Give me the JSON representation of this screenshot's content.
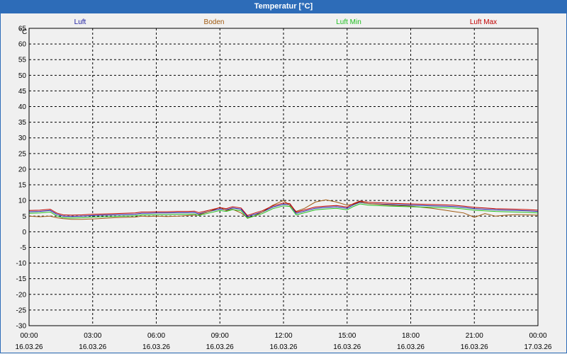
{
  "window": {
    "title": "Temperatur [°C]"
  },
  "chart_data": {
    "type": "line",
    "title": "Temperatur [°C]",
    "ylabel": "°C",
    "xlabel": "",
    "ylim": [
      -30,
      65
    ],
    "y_ticks": [
      65,
      60,
      55,
      50,
      45,
      40,
      35,
      30,
      25,
      20,
      15,
      10,
      5,
      0,
      -5,
      -10,
      -15,
      -20,
      -25,
      -30
    ],
    "x_ticks": [
      {
        "time": "00:00",
        "date": "16.03.26"
      },
      {
        "time": "03:00",
        "date": "16.03.26"
      },
      {
        "time": "06:00",
        "date": "16.03.26"
      },
      {
        "time": "09:00",
        "date": "16.03.26"
      },
      {
        "time": "12:00",
        "date": "16.03.26"
      },
      {
        "time": "15:00",
        "date": "16.03.26"
      },
      {
        "time": "18:00",
        "date": "16.03.26"
      },
      {
        "time": "21:00",
        "date": "16.03.26"
      },
      {
        "time": "00:00",
        "date": "17.03.26"
      }
    ],
    "grid": true,
    "legend_position": "top",
    "x_unit": "hours",
    "series": [
      {
        "name": "Luft",
        "color": "#1a1aa0",
        "x": [
          0,
          0.5,
          1,
          1.3,
          1.6,
          2,
          2.5,
          3,
          3.5,
          4,
          4.5,
          5,
          5.3,
          5.6,
          6,
          6.5,
          7,
          7.5,
          7.8,
          8,
          8.5,
          9,
          9.3,
          9.6,
          10,
          10.3,
          10.6,
          11,
          11.5,
          12,
          12.3,
          12.6,
          13,
          13.5,
          14,
          14.5,
          15,
          15.3,
          15.6,
          16,
          17,
          18,
          19,
          19.5,
          20,
          20.5,
          21,
          21.5,
          22,
          22.5,
          23,
          23.5,
          24
        ],
        "y": [
          6.4,
          6.5,
          6.8,
          5.6,
          5.0,
          4.9,
          5.0,
          5.2,
          5.3,
          5.4,
          5.5,
          5.6,
          5.9,
          5.9,
          6.0,
          6.0,
          6.1,
          6.1,
          6.2,
          5.7,
          6.5,
          7.3,
          7.0,
          7.6,
          7.2,
          4.8,
          5.5,
          6.3,
          7.9,
          8.8,
          8.6,
          5.9,
          6.6,
          7.5,
          7.8,
          8.0,
          7.5,
          8.6,
          9.4,
          9.0,
          8.7,
          8.5,
          8.3,
          8.2,
          8.1,
          7.8,
          7.4,
          7.2,
          7.0,
          6.9,
          6.8,
          6.7,
          6.5
        ]
      },
      {
        "name": "Boden",
        "color": "#a05a10",
        "x": [
          0,
          0.5,
          1,
          1.3,
          1.6,
          2,
          2.5,
          3,
          3.5,
          4,
          4.5,
          5,
          5.3,
          5.6,
          6,
          6.5,
          7,
          7.5,
          7.8,
          8,
          8.5,
          9,
          9.3,
          9.6,
          10,
          10.3,
          10.6,
          11,
          11.5,
          12,
          12.3,
          12.6,
          13,
          13.5,
          14,
          14.5,
          15,
          15.3,
          15.6,
          16,
          17,
          18,
          19,
          19.5,
          20,
          20.5,
          21,
          21.5,
          22,
          22.5,
          23,
          23.5,
          24
        ],
        "y": [
          5.0,
          4.8,
          5.0,
          4.5,
          4.2,
          4.0,
          4.0,
          4.1,
          4.3,
          4.5,
          4.6,
          4.7,
          5.0,
          4.9,
          5.0,
          4.9,
          5.0,
          5.2,
          5.3,
          5.4,
          6.5,
          7.8,
          6.8,
          7.2,
          6.0,
          4.5,
          5.0,
          6.3,
          8.5,
          10.0,
          8.4,
          6.5,
          7.5,
          9.5,
          10.2,
          9.5,
          8.5,
          8.8,
          9.6,
          9.0,
          8.5,
          8.2,
          7.5,
          7.0,
          6.5,
          6.0,
          4.6,
          5.8,
          5.0,
          5.3,
          5.5,
          5.4,
          5.3
        ]
      },
      {
        "name": "Luft Min",
        "color": "#1fbf1f",
        "x": [
          0,
          0.5,
          1,
          1.3,
          1.6,
          2,
          2.5,
          3,
          3.5,
          4,
          4.5,
          5,
          5.3,
          5.6,
          6,
          6.5,
          7,
          7.5,
          7.8,
          8,
          8.5,
          9,
          9.3,
          9.6,
          10,
          10.3,
          10.6,
          11,
          11.5,
          12,
          12.3,
          12.6,
          13,
          13.5,
          14,
          14.5,
          15,
          15.3,
          15.6,
          16,
          17,
          18,
          19,
          19.5,
          20,
          20.5,
          21,
          21.5,
          22,
          22.5,
          23,
          23.5,
          24
        ],
        "y": [
          5.9,
          6.0,
          6.3,
          5.1,
          4.5,
          4.4,
          4.5,
          4.7,
          4.8,
          4.9,
          5.0,
          5.1,
          5.4,
          5.4,
          5.5,
          5.5,
          5.6,
          5.6,
          5.7,
          5.2,
          6.0,
          6.8,
          6.5,
          7.1,
          6.7,
          4.3,
          5.0,
          5.8,
          7.4,
          8.3,
          8.1,
          5.4,
          6.1,
          7.0,
          7.3,
          7.5,
          7.0,
          8.1,
          8.9,
          8.5,
          8.2,
          8.0,
          7.8,
          7.7,
          7.6,
          7.3,
          6.9,
          6.7,
          6.5,
          6.4,
          6.3,
          6.2,
          6.0
        ]
      },
      {
        "name": "Luft Max",
        "color": "#c00000",
        "x": [
          0,
          0.5,
          1,
          1.3,
          1.6,
          2,
          2.5,
          3,
          3.5,
          4,
          4.5,
          5,
          5.3,
          5.6,
          6,
          6.5,
          7,
          7.5,
          7.8,
          8,
          8.5,
          9,
          9.3,
          9.6,
          10,
          10.3,
          10.6,
          11,
          11.5,
          12,
          12.3,
          12.6,
          13,
          13.5,
          14,
          14.5,
          15,
          15.3,
          15.6,
          16,
          17,
          18,
          19,
          19.5,
          20,
          20.5,
          21,
          21.5,
          22,
          22.5,
          23,
          23.5,
          24
        ],
        "y": [
          6.8,
          6.9,
          7.2,
          6.0,
          5.4,
          5.3,
          5.4,
          5.6,
          5.7,
          5.8,
          5.9,
          6.0,
          6.3,
          6.3,
          6.4,
          6.4,
          6.5,
          6.5,
          6.6,
          6.1,
          6.9,
          7.7,
          7.4,
          8.0,
          7.6,
          5.2,
          5.9,
          6.7,
          8.3,
          9.2,
          9.0,
          6.3,
          7.0,
          7.9,
          8.2,
          8.4,
          7.9,
          9.0,
          9.8,
          9.4,
          9.1,
          8.9,
          8.7,
          8.6,
          8.5,
          8.2,
          7.8,
          7.6,
          7.4,
          7.3,
          7.2,
          7.1,
          6.9
        ]
      }
    ]
  }
}
